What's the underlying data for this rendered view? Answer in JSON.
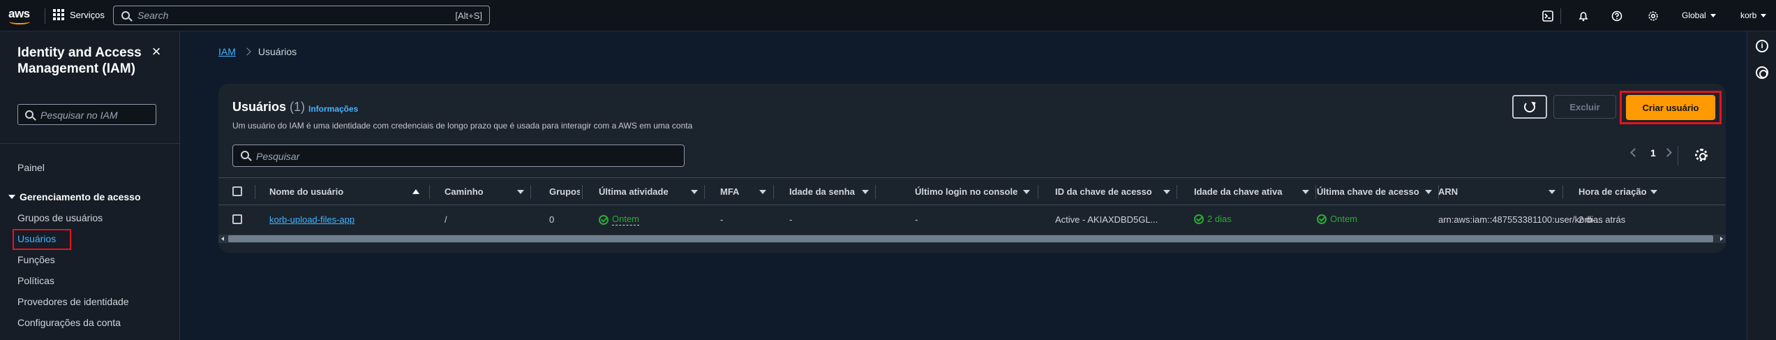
{
  "topnav": {
    "logo_text": "aws",
    "services_label": "Serviços",
    "search_placeholder": "Search",
    "search_shortcut": "[Alt+S]",
    "region_label": "Global",
    "account_label": "korb"
  },
  "sidebar": {
    "title": "Identity and Access Management (IAM)",
    "search_placeholder": "Pesquisar no IAM",
    "dashboard_label": "Painel",
    "section_label": "Gerenciamento de acesso",
    "items": [
      {
        "label": "Grupos de usuários"
      },
      {
        "label": "Usuários"
      },
      {
        "label": "Funções"
      },
      {
        "label": "Políticas"
      },
      {
        "label": "Provedores de identidade"
      },
      {
        "label": "Configurações da conta"
      }
    ]
  },
  "breadcrumb": {
    "root": "IAM",
    "current": "Usuários"
  },
  "panel": {
    "title": "Usuários",
    "count": "(1)",
    "info_label": "Informações",
    "description": "Um usuário do IAM é uma identidade com credenciais de longo prazo que é usada para interagir com a AWS em uma conta",
    "delete_label": "Excluir",
    "create_label": "Criar usuário",
    "search_placeholder": "Pesquisar",
    "page_number": "1"
  },
  "table": {
    "columns": [
      "Nome do usuário",
      "Caminho",
      "Grupos",
      "Última atividade",
      "MFA",
      "Idade da senha",
      "Último login no console",
      "ID da chave de acesso",
      "Idade da chave ativa",
      "Última chave de acesso",
      "ARN",
      "Hora de criação"
    ],
    "rows": [
      {
        "username": "korb-upload-files-app",
        "path": "/",
        "groups": "0",
        "last_activity": "Ontem",
        "mfa": "-",
        "password_age": "-",
        "last_console_login": "-",
        "access_key_id": "Active - AKIAXDBD5GL...",
        "key_age": "2 dias",
        "last_key_used": "Ontem",
        "arn": "arn:aws:iam::487553381100:user/korb-...",
        "created": "2 dias atrás"
      }
    ]
  },
  "colors": {
    "accent_orange": "#ff9900",
    "link_blue": "#42b4ff",
    "success_green": "#29ad32",
    "highlight_red": "#e3141e"
  },
  "icons": [
    "grid-icon",
    "search-icon",
    "cloudshell-icon",
    "bell-icon",
    "help-icon",
    "settings-icon",
    "close-icon",
    "refresh-icon",
    "check-circle-icon",
    "info-icon",
    "gear-icon"
  ]
}
